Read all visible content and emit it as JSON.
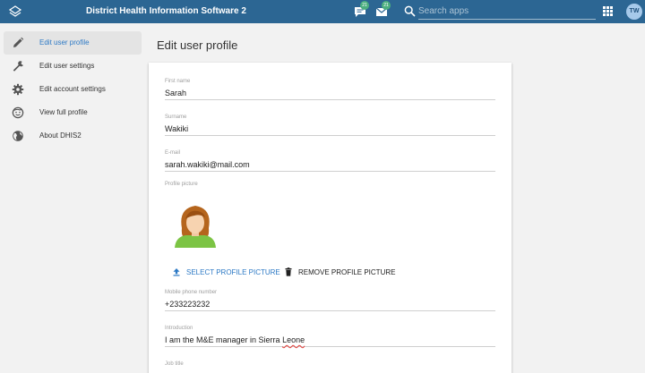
{
  "header": {
    "title": "District Health Information Software 2",
    "interpretations_badge": "21",
    "messages_badge": "21",
    "search_placeholder": "Search apps",
    "user_initials": "TW"
  },
  "sidebar": {
    "items": [
      {
        "label": "Edit user profile",
        "icon": "pencil-icon",
        "active": true
      },
      {
        "label": "Edit user settings",
        "icon": "wrench-icon"
      },
      {
        "label": "Edit account settings",
        "icon": "gear-icon"
      },
      {
        "label": "View full profile",
        "icon": "face-icon"
      },
      {
        "label": "About DHIS2",
        "icon": "globe-icon"
      }
    ]
  },
  "main": {
    "title": "Edit user profile",
    "fields": {
      "first_name": {
        "label": "First name",
        "value": "Sarah"
      },
      "surname": {
        "label": "Surname",
        "value": "Wakiki"
      },
      "email": {
        "label": "E-mail",
        "value": "sarah.wakiki@mail.com"
      },
      "profile_picture": {
        "label": "Profile picture"
      },
      "mobile": {
        "label": "Mobile phone number",
        "value": "+233223232"
      },
      "introduction": {
        "label": "Introduction",
        "value_prefix": "I am the M&E manager in Sierra ",
        "value_flagged": "Leone"
      },
      "job_title": {
        "label": "Job title",
        "value": ""
      }
    },
    "select_picture_label": "SELECT PROFILE PICTURE",
    "remove_picture_label": "REMOVE PROFILE PICTURE"
  },
  "colors": {
    "header_bg": "#2c6693",
    "accent": "#2c79c5",
    "badge": "#4caf7f"
  }
}
